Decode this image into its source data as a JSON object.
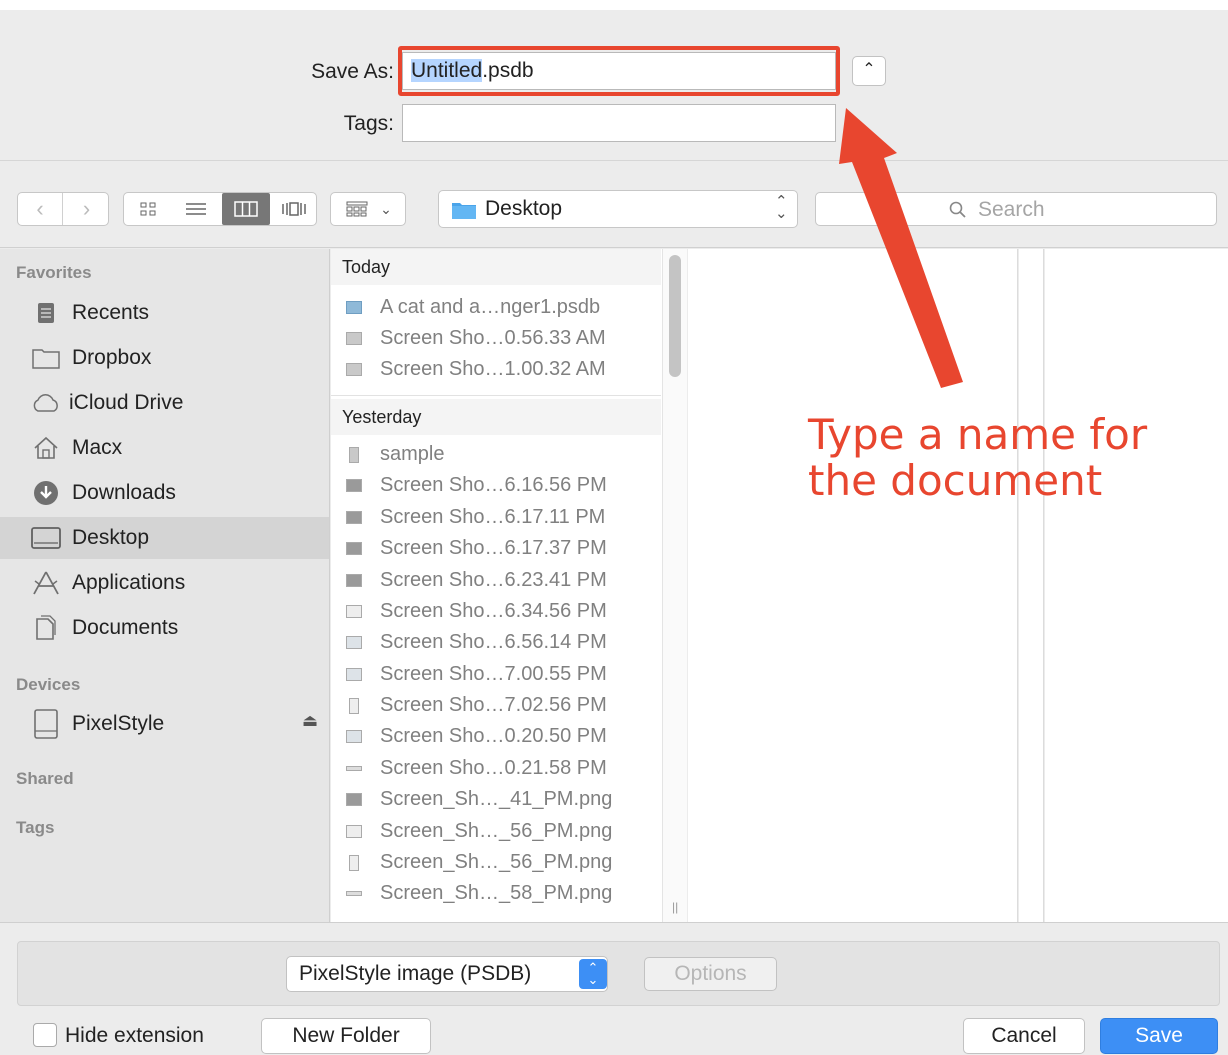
{
  "header": {
    "save_as_label": "Save As:",
    "filename_selected": "Untitled",
    "filename_ext": ".psdb",
    "tags_label": "Tags:",
    "tags_value": ""
  },
  "toolbar": {
    "location": "Desktop",
    "search_placeholder": "Search"
  },
  "sidebar": {
    "favorites_heading": "Favorites",
    "favorites": [
      {
        "label": "Recents",
        "icon": "recents-icon"
      },
      {
        "label": "Dropbox",
        "icon": "folder-icon"
      },
      {
        "label": "iCloud Drive",
        "icon": "cloud-icon"
      },
      {
        "label": "Macx",
        "icon": "home-icon"
      },
      {
        "label": "Downloads",
        "icon": "downloads-icon"
      },
      {
        "label": "Desktop",
        "icon": "desktop-icon"
      },
      {
        "label": "Applications",
        "icon": "applications-icon"
      },
      {
        "label": "Documents",
        "icon": "documents-icon"
      }
    ],
    "devices_heading": "Devices",
    "devices": [
      {
        "label": "PixelStyle",
        "icon": "disk-icon"
      }
    ],
    "shared_heading": "Shared",
    "tags_heading": "Tags"
  },
  "files": {
    "today_heading": "Today",
    "today": [
      "A cat and a…nger1.psdb",
      "Screen Sho…0.56.33 AM",
      "Screen Sho…1.00.32 AM"
    ],
    "yesterday_heading": "Yesterday",
    "yesterday": [
      "sample",
      "Screen Sho…6.16.56 PM",
      "Screen Sho…6.17.11 PM",
      "Screen Sho…6.17.37 PM",
      "Screen Sho…6.23.41 PM",
      "Screen Sho…6.34.56 PM",
      "Screen Sho…6.56.14 PM",
      "Screen Sho…7.00.55 PM",
      "Screen Sho…7.02.56 PM",
      "Screen Sho…0.20.50 PM",
      "Screen Sho…0.21.58 PM",
      "Screen_Sh…_41_PM.png",
      "Screen_Sh…_56_PM.png",
      "Screen_Sh…_56_PM.png",
      "Screen_Sh…_58_PM.png"
    ]
  },
  "bottom": {
    "format_value": "PixelStyle image (PSDB)",
    "options_label": "Options",
    "hide_extension_label": "Hide extension",
    "new_folder_label": "New Folder",
    "cancel_label": "Cancel",
    "save_label": "Save"
  },
  "annotation": {
    "text": "Type a name for\nthe document",
    "color": "#e8462f"
  },
  "colors": {
    "accent_blue": "#3d8ff5",
    "annotation_red": "#e8462f"
  }
}
